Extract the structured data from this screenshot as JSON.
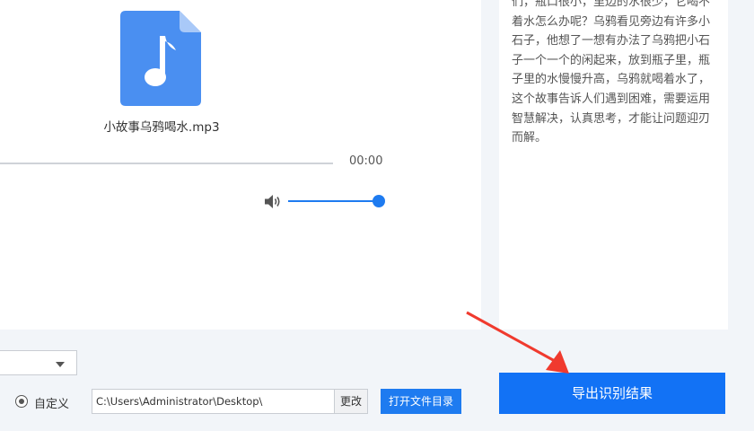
{
  "player": {
    "file_name": "小故事乌鸦喝水.mp3",
    "time": "00:00",
    "progress": 0,
    "volume": 1.0,
    "file_icon": "music-file-icon",
    "volume_icon": "speaker-icon",
    "accent_color": "#1e7bf0"
  },
  "result": {
    "text": "们，瓶口很小，里边的水很少，它喝不着水怎么办呢？乌鸦看见旁边有许多小石子，他想了一想有办法了乌鸦把小石子一个一个的闲起来，放到瓶子里，瓶子里的水慢慢升高，乌鸦就喝着水了，这个故事告诉人们遇到困难，需要运用智慧解决，认真思考，才能让问题迎刃而解。"
  },
  "output": {
    "format_select_value": "",
    "radio_label": "自定义",
    "radio_checked": true,
    "path_value": "C:\\Users\\Administrator\\Desktop\\",
    "change_label": "更改",
    "open_dir_label": "打开文件目录"
  },
  "export": {
    "label": "导出识别结果",
    "color": "#1272f5"
  },
  "annotation": {
    "arrow_color": "#f03a2e"
  }
}
